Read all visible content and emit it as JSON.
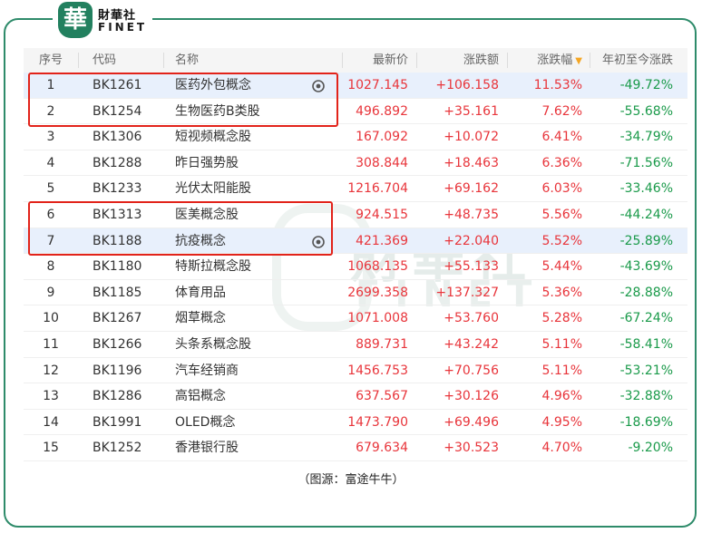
{
  "brand": {
    "mark": "華",
    "name_cn": "財華社",
    "name_en": "FINET"
  },
  "watermark": {
    "cn": "財華社",
    "en": "FINET"
  },
  "headers": {
    "idx": "序号",
    "code": "代码",
    "name": "名称",
    "price": "最新价",
    "chg": "涨跌额",
    "pct": "涨跌幅",
    "ytd": "年初至今涨跌"
  },
  "rows": [
    {
      "idx": "1",
      "code": "BK1261",
      "name": "医药外包概念",
      "price": "1027.145",
      "chg": "+106.158",
      "pct": "11.53%",
      "ytd": "-49.72%"
    },
    {
      "idx": "2",
      "code": "BK1254",
      "name": "生物医药B类股",
      "price": "496.892",
      "chg": "+35.161",
      "pct": "7.62%",
      "ytd": "-55.68%"
    },
    {
      "idx": "3",
      "code": "BK1306",
      "name": "短视频概念股",
      "price": "167.092",
      "chg": "+10.072",
      "pct": "6.41%",
      "ytd": "-34.79%"
    },
    {
      "idx": "4",
      "code": "BK1288",
      "name": "昨日强势股",
      "price": "308.844",
      "chg": "+18.463",
      "pct": "6.36%",
      "ytd": "-71.56%"
    },
    {
      "idx": "5",
      "code": "BK1233",
      "name": "光伏太阳能股",
      "price": "1216.704",
      "chg": "+69.162",
      "pct": "6.03%",
      "ytd": "-33.46%"
    },
    {
      "idx": "6",
      "code": "BK1313",
      "name": "医美概念股",
      "price": "924.515",
      "chg": "+48.735",
      "pct": "5.56%",
      "ytd": "-44.24%"
    },
    {
      "idx": "7",
      "code": "BK1188",
      "name": "抗疫概念",
      "price": "421.369",
      "chg": "+22.040",
      "pct": "5.52%",
      "ytd": "-25.89%"
    },
    {
      "idx": "8",
      "code": "BK1180",
      "name": "特斯拉概念股",
      "price": "1068.135",
      "chg": "+55.133",
      "pct": "5.44%",
      "ytd": "-43.69%"
    },
    {
      "idx": "9",
      "code": "BK1185",
      "name": "体育用品",
      "price": "2699.358",
      "chg": "+137.327",
      "pct": "5.36%",
      "ytd": "-28.88%"
    },
    {
      "idx": "10",
      "code": "BK1267",
      "name": "烟草概念",
      "price": "1071.008",
      "chg": "+53.760",
      "pct": "5.28%",
      "ytd": "-67.24%"
    },
    {
      "idx": "11",
      "code": "BK1266",
      "name": "头条系概念股",
      "price": "889.731",
      "chg": "+43.242",
      "pct": "5.11%",
      "ytd": "-58.41%"
    },
    {
      "idx": "12",
      "code": "BK1196",
      "name": "汽车经销商",
      "price": "1456.753",
      "chg": "+70.756",
      "pct": "5.11%",
      "ytd": "-53.21%"
    },
    {
      "idx": "13",
      "code": "BK1286",
      "name": "高铝概念",
      "price": "637.567",
      "chg": "+30.126",
      "pct": "4.96%",
      "ytd": "-32.88%"
    },
    {
      "idx": "14",
      "code": "BK1991",
      "name": "OLED概念",
      "price": "1473.790",
      "chg": "+69.496",
      "pct": "4.95%",
      "ytd": "-18.69%"
    },
    {
      "idx": "15",
      "code": "BK1252",
      "name": "香港银行股",
      "price": "679.634",
      "chg": "+30.523",
      "pct": "4.70%",
      "ytd": "-9.20%"
    }
  ],
  "selected_rows": [
    0,
    6
  ],
  "highlighted_groups": [
    [
      0,
      1
    ],
    [
      5,
      6
    ]
  ],
  "source": "（图源：富途牛牛）",
  "colors": {
    "up": "#e8353b",
    "down": "#1a9a4a",
    "frame": "#2e8b6a",
    "highlight_box": "#e2231a",
    "selected_row_bg": "#e8f0fc",
    "sort_caret": "#f5a623"
  },
  "icons": {
    "row_action": "eye-icon",
    "sort_indicator": "sort-descending-caret-icon"
  }
}
